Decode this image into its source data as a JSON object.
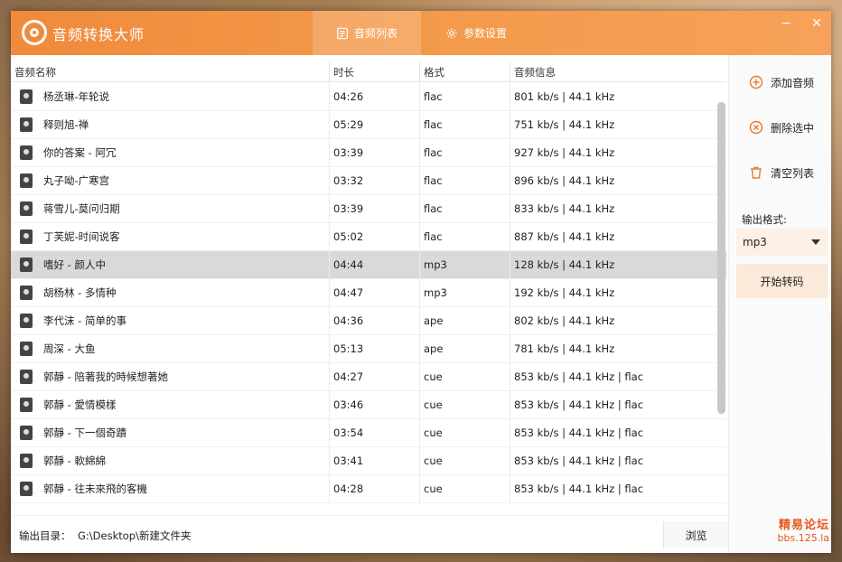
{
  "app": {
    "title": "音频转换大师"
  },
  "tabs": [
    {
      "label": "音频列表",
      "icon": "list-icon",
      "active": true
    },
    {
      "label": "参数设置",
      "icon": "gear-icon",
      "active": false
    }
  ],
  "window_controls": {
    "minimize": "−",
    "close": "✕"
  },
  "table": {
    "headers": {
      "name": "音频名称",
      "duration": "时长",
      "format": "格式",
      "info": "音频信息"
    },
    "rows": [
      {
        "name": "杨丞琳-年轮说",
        "duration": "04:26",
        "format": "flac",
        "info": "801 kb/s  |  44.1 kHz"
      },
      {
        "name": "释则旭-禅",
        "duration": "05:29",
        "format": "flac",
        "info": "751 kb/s  |  44.1 kHz"
      },
      {
        "name": "你的答案 - 阿冗",
        "duration": "03:39",
        "format": "flac",
        "info": "927 kb/s  |  44.1 kHz"
      },
      {
        "name": "丸子呦-广寒宫",
        "duration": "03:32",
        "format": "flac",
        "info": "896 kb/s  |  44.1 kHz"
      },
      {
        "name": "蒋雪儿-莫问归期",
        "duration": "03:39",
        "format": "flac",
        "info": "833 kb/s  |  44.1 kHz"
      },
      {
        "name": "丁芙妮-时间说客",
        "duration": "05:02",
        "format": "flac",
        "info": "887 kb/s  |  44.1 kHz"
      },
      {
        "name": "嗜好 - 颜人中",
        "duration": "04:44",
        "format": "mp3",
        "info": "128 kb/s  |  44.1 kHz",
        "selected": true
      },
      {
        "name": "胡杨林 - 多情种",
        "duration": "04:47",
        "format": "mp3",
        "info": "192 kb/s  |  44.1 kHz"
      },
      {
        "name": "李代沫 - 简单的事",
        "duration": "04:36",
        "format": "ape",
        "info": "802 kb/s  |  44.1 kHz"
      },
      {
        "name": "周深 - 大鱼",
        "duration": "05:13",
        "format": "ape",
        "info": "781 kb/s  |  44.1 kHz"
      },
      {
        "name": "郭靜 - 陪著我的時候想著她",
        "duration": "04:27",
        "format": "cue",
        "info": "853 kb/s  |  44.1 kHz  |  flac"
      },
      {
        "name": "郭靜 - 愛情模樣",
        "duration": "03:46",
        "format": "cue",
        "info": "853 kb/s  |  44.1 kHz  |  flac"
      },
      {
        "name": "郭靜 - 下一個奇蹟",
        "duration": "03:54",
        "format": "cue",
        "info": "853 kb/s  |  44.1 kHz  |  flac"
      },
      {
        "name": "郭靜 - 軟綿綿",
        "duration": "03:41",
        "format": "cue",
        "info": "853 kb/s  |  44.1 kHz  |  flac"
      },
      {
        "name": "郭靜 - 往未來飛的客機",
        "duration": "04:28",
        "format": "cue",
        "info": "853 kb/s  |  44.1 kHz  |  flac"
      }
    ]
  },
  "output": {
    "label": "输出目录：",
    "path": "G:\\Desktop\\新建文件夹",
    "browse": "浏览"
  },
  "sidebar": {
    "add": "添加音频",
    "delete": "删除选中",
    "clear": "清空列表",
    "format_label": "输出格式:",
    "format_value": "mp3",
    "start": "开始转码"
  },
  "watermark": {
    "line1": "精易论坛",
    "line2": "bbs.125.la"
  },
  "colors": {
    "accent": "#f08a3c",
    "accent_light": "#fbe9da",
    "icon_orange": "#e87a2e"
  }
}
